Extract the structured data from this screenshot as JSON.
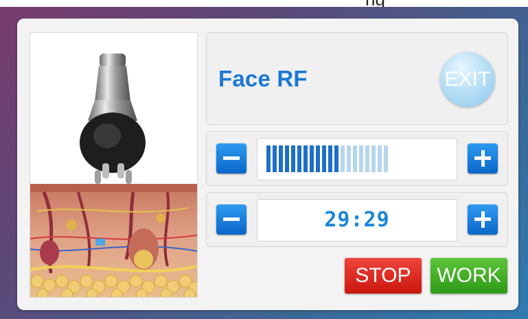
{
  "header_clip": "ng",
  "title": "Face RF",
  "exit_label": "EXIT",
  "intensity": {
    "filled": 12,
    "total": 20,
    "filled_color": "#1e6fc9",
    "empty_color": "#b8d5ee"
  },
  "timer": {
    "value": "29:29"
  },
  "buttons": {
    "stop": "STOP",
    "work": "WORK"
  },
  "colors": {
    "accent": "#1a78d6",
    "stop": "#e0261d",
    "work": "#42ad26",
    "exit": "#aadbf4"
  },
  "icons": {
    "minus": "minus-icon",
    "plus": "plus-icon"
  }
}
